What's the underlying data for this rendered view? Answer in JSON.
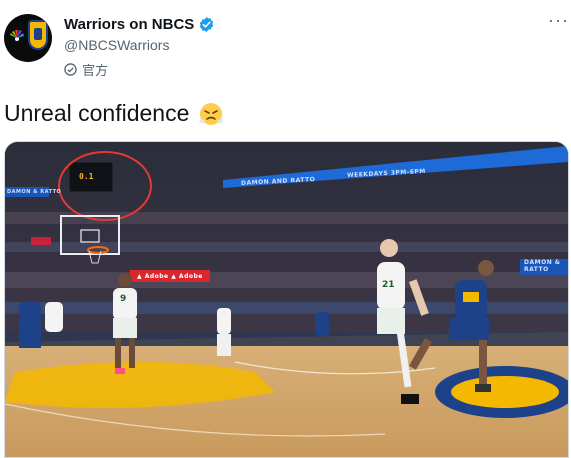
{
  "author": {
    "display_name": "Warriors on NBCS",
    "handle": "@NBCSWarriors",
    "label": "官方"
  },
  "icons": {
    "verified": "verified-badge-icon",
    "label": "shield-check-icon",
    "more": "more-options-icon",
    "emoji": "face-with-steam-icon"
  },
  "tweet": {
    "text": "Unreal confidence"
  },
  "media": {
    "shot_clock": "0.1",
    "ribbon_text": "DAMON AND RATTO",
    "ribbon_sub": "WEEKDAYS 3PM-6PM",
    "right_board_line1": "DAMON &",
    "right_board_line2": "RATTO",
    "left_board_text": "DAMON & RATTO",
    "mid_banner": "▲ Adobe ▲ Adobe",
    "jersey_left": "9",
    "jersey_center": "21"
  },
  "colors": {
    "verified_blue": "#1d9bf0",
    "secondary_text": "#536471",
    "annotation_red": "#e53935",
    "warriors_blue": "#1d428a",
    "warriors_gold": "#f5b800"
  }
}
